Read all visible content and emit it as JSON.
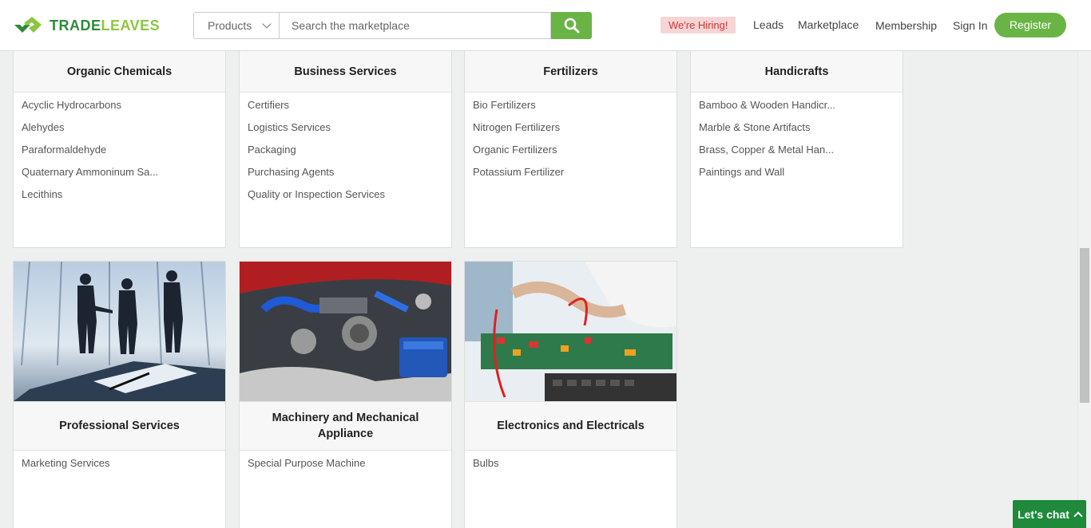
{
  "header": {
    "logo_part1": "TRADE",
    "logo_part2": "LEAVES",
    "search_category": "Products",
    "search_placeholder": "Search the marketplace",
    "hiring_badge": "We're Hiring!",
    "nav": {
      "leads": "Leads",
      "marketplace": "Marketplace",
      "membership": "Membership",
      "sign_in": "Sign In",
      "register": "Register"
    }
  },
  "categories_row1": [
    {
      "title": "Organic Chemicals",
      "items": [
        "Acyclic Hydrocarbons",
        "Alehydes",
        "Paraformaldehyde",
        "Quaternary Ammoninum Sa...",
        "Lecithins"
      ]
    },
    {
      "title": "Business Services",
      "items": [
        "Certifiers",
        "Logistics Services",
        "Packaging",
        "Purchasing Agents",
        "Quality or Inspection Services"
      ]
    },
    {
      "title": "Fertilizers",
      "items": [
        "Bio Fertilizers",
        "Nitrogen Fertilizers",
        "Organic Fertilizers",
        "Potassium Fertilizer"
      ]
    },
    {
      "title": "Handicrafts",
      "items": [
        "Bamboo & Wooden Handicr...",
        "Marble & Stone Artifacts",
        "Brass, Copper & Metal Han...",
        "Paintings and Wall"
      ]
    }
  ],
  "categories_row2": [
    {
      "title": "Professional Services",
      "image": "business-handshake-photo",
      "items": [
        "Marketing Services"
      ]
    },
    {
      "title": "Machinery and Mechanical Appliance",
      "image": "car-engine-photo",
      "items": [
        "Special Purpose Machine"
      ]
    },
    {
      "title": "Electronics and Electricals",
      "image": "circuit-board-multimeter-photo",
      "items": [
        "Bulbs"
      ]
    }
  ],
  "chat": {
    "label": "Let's chat"
  },
  "colors": {
    "brand_green": "#6ab446",
    "dark_green": "#1e8a3a",
    "hiring_bg": "#f5d5d5",
    "hiring_text": "#dd3333"
  }
}
